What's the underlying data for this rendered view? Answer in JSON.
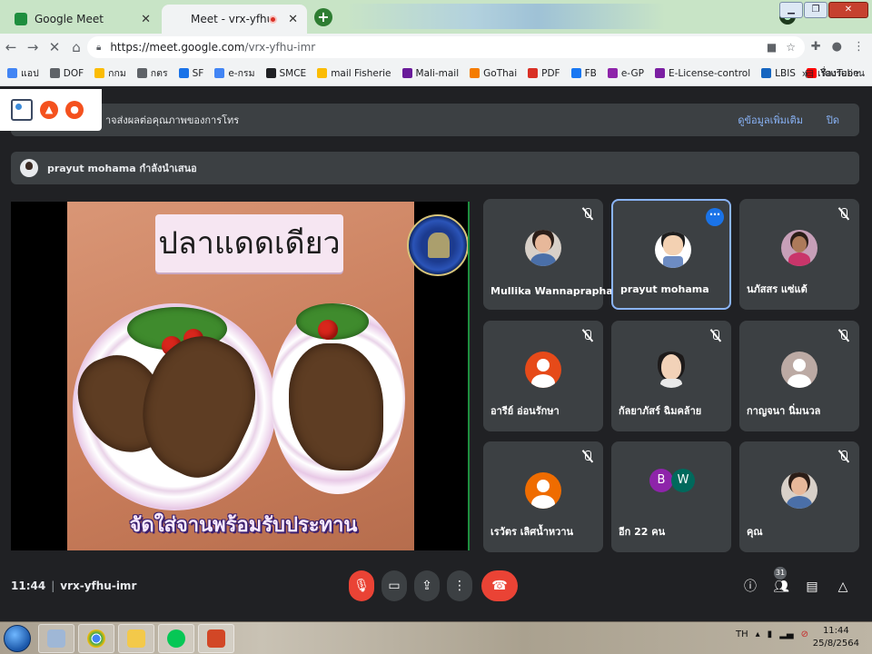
{
  "browser": {
    "tabs": [
      {
        "title": "Google Meet",
        "favicon_color": "#1e8e3e"
      },
      {
        "title": "Meet - vrx-yfhu-imr",
        "favicon_color": "#ffffff"
      }
    ],
    "new_tab": "+",
    "url_host": "https://meet.google.com",
    "url_path": "/vrx-yfhu-imr"
  },
  "bookmarks": [
    {
      "label": "แอป",
      "color": "#4285f4"
    },
    {
      "label": "DOF",
      "color": "#5f6368"
    },
    {
      "label": "กกม",
      "color": "#fbbc04"
    },
    {
      "label": "กตร",
      "color": "#5f6368"
    },
    {
      "label": "SF",
      "color": "#1a73e8"
    },
    {
      "label": "e-กรม",
      "color": "#4285f4"
    },
    {
      "label": "SMCE",
      "color": "#202124"
    },
    {
      "label": "mail Fisherie",
      "color": "#fbbc04"
    },
    {
      "label": "Mali-mail",
      "color": "#6a1b9a"
    },
    {
      "label": "GoThai",
      "color": "#f57c00"
    },
    {
      "label": "PDF",
      "color": "#d93025"
    },
    {
      "label": "FB",
      "color": "#1877f2"
    },
    {
      "label": "e-GP",
      "color": "#8e24aa"
    },
    {
      "label": "E-License-control",
      "color": "#7b1fa2"
    },
    {
      "label": "LBIS",
      "color": "#1565c0"
    },
    {
      "label": "YouTube",
      "color": "#ff0000"
    }
  ],
  "bookmarks_more": "»",
  "reading_list": "เรื่องรออ่าน",
  "notice": {
    "message": "าจส่งผลต่อคุณภาพของการโทร",
    "more": "ดูข้อมูลเพิ่มเติม",
    "close": "ปิด"
  },
  "presenter": {
    "text": "prayut mohama กำลังนำเสนอ"
  },
  "slide": {
    "title": "ปลาแดดเดียว",
    "caption": "จัดใส่จานพร้อมรับประทาน"
  },
  "participants": [
    {
      "name": "Mullika Wannaprapha",
      "avatar": "photo",
      "muted": true
    },
    {
      "name": "prayut mohama",
      "avatar": "cartoon",
      "muted": false,
      "active": true
    },
    {
      "name": "นภัสสร แซ่แต้",
      "avatar": "mask",
      "muted": true
    },
    {
      "name": "อารีย์ อ่อนรักษา",
      "avatar": "generic-red",
      "muted": true
    },
    {
      "name": "กัลยาภัสร์ ฉิมคล้าย",
      "avatar": "girl",
      "muted": true
    },
    {
      "name": "กาญจนา นิ่มนวล",
      "avatar": "generic-grey",
      "muted": true
    },
    {
      "name": "เรวัตร เลิศน้ำหวาน",
      "avatar": "generic-orange",
      "muted": true
    },
    {
      "name": "อีก 22 คน",
      "avatar": "letters",
      "letters": [
        "B",
        "W"
      ],
      "muted": false
    },
    {
      "name": "คุณ",
      "avatar": "photo",
      "muted": true
    }
  ],
  "meeting": {
    "time": "11:44",
    "sep": "|",
    "code": "vrx-yfhu-imr",
    "people_count": "31"
  },
  "taskbar": {
    "lang": "TH",
    "time": "11:44",
    "date": "25/8/2564"
  }
}
